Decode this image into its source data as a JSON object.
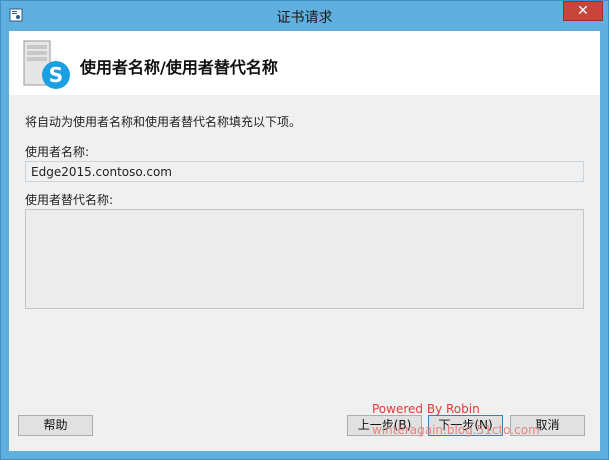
{
  "window": {
    "title": "证书请求",
    "close_glyph": "✕",
    "app_icon": "certificate-icon"
  },
  "header": {
    "icon": "skype-server-icon",
    "title": "使用者名称/使用者替代名称"
  },
  "content": {
    "description": "将自动为使用者名称和使用者替代名称填充以下项。",
    "subject_label": "使用者名称:",
    "subject_value": "Edge2015.contoso.com",
    "san_label": "使用者替代名称:",
    "san_items": []
  },
  "buttons": {
    "help": "帮助",
    "back": "上一步(B)",
    "next": "下一步(N)",
    "cancel": "取消"
  },
  "watermark": {
    "line1": "Powered By Robin",
    "line2": "winteragain.blog.51cto.com"
  },
  "colors": {
    "titlebar": "#5fb0de",
    "close": "#c7463c",
    "accent_border": "#3c7fb1"
  }
}
